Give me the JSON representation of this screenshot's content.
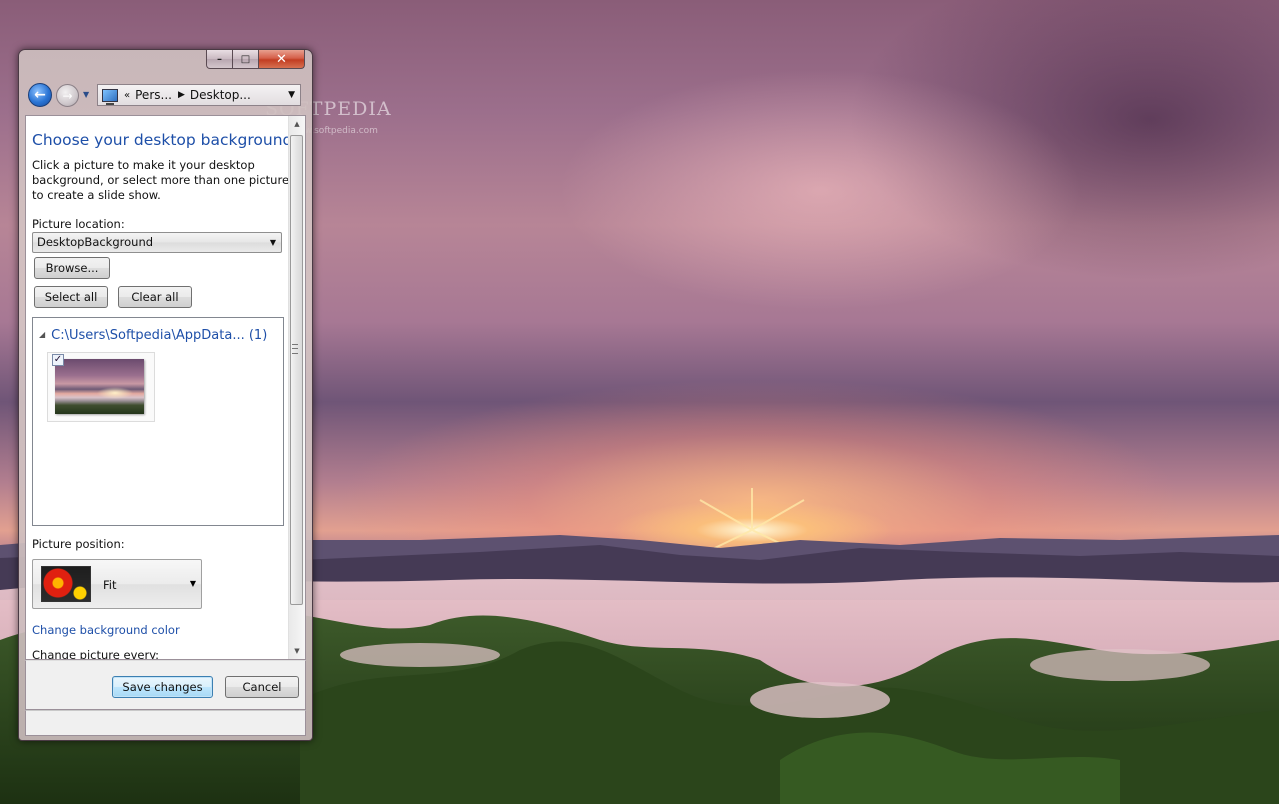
{
  "watermark": {
    "brand": "SOFTPEDIA",
    "url": "www.softpedia.com"
  },
  "window": {
    "caption": {
      "minimize_glyph": "–",
      "maximize_glyph": "□",
      "close_glyph": "✕"
    },
    "nav": {
      "back_glyph": "←",
      "forward_glyph": "→",
      "recent_glyph": "▼"
    },
    "address": {
      "prefix": "«",
      "crumbs": [
        "Pers...",
        "Desktop..."
      ],
      "separator": "▶",
      "dropdown_glyph": "▼"
    },
    "content": {
      "title": "Choose your desktop background",
      "description": "Click a picture to make it your desktop background, or select more than one picture to create a slide show.",
      "location_label": "Picture location:",
      "location_value": "DesktopBackground",
      "browse_label": "Browse...",
      "select_all_label": "Select all",
      "clear_all_label": "Clear all",
      "group": {
        "chevron": "◢",
        "path": "C:\\Users\\Softpedia\\AppData... (1)"
      },
      "thumbnail_checked": "✓",
      "position_label": "Picture position:",
      "position_value": "Fit",
      "bgcolor_link": "Change background color",
      "change_every_label": "Change picture every:"
    },
    "footer": {
      "save_label": "Save changes",
      "cancel_label": "Cancel"
    },
    "scrollbar": {
      "up_glyph": "▲",
      "down_glyph": "▼"
    }
  },
  "colors": {
    "link_blue": "#1e4fa8",
    "close_red": "#c23d22"
  }
}
